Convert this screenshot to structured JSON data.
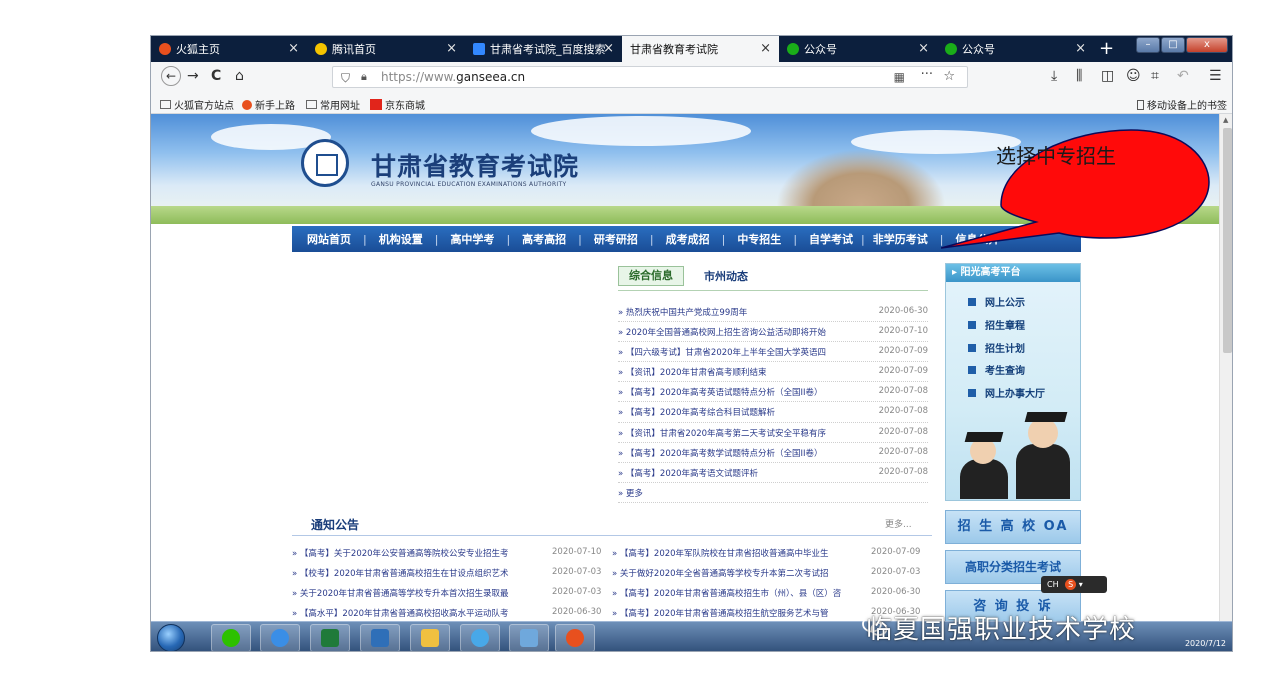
{
  "browser": {
    "tabs": [
      {
        "label": "火狐主页",
        "icon": "firefox-icon",
        "color": "#e8501e"
      },
      {
        "label": "腾讯首页",
        "icon": "qq-icon",
        "color": "#f5c400"
      },
      {
        "label": "甘肃省考试院_百度搜索",
        "icon": "baidu-paw-icon",
        "color": "#3388ff"
      },
      {
        "label": "甘肃省教育考试院",
        "icon": "",
        "color": ""
      },
      {
        "label": "公众号",
        "icon": "wechat-official-icon",
        "color": "#1aad19"
      },
      {
        "label": "公众号",
        "icon": "wechat-official-icon",
        "color": "#1aad19"
      }
    ],
    "new_tab": "+",
    "window_buttons": {
      "minimize": "–",
      "maximize": "□",
      "close": "x"
    },
    "nav": {
      "back": "←",
      "forward": "→",
      "reload": "C",
      "home": "⌂"
    },
    "url": {
      "protocol": "https://www.",
      "domain": "ganseea.cn"
    },
    "url_icons": {
      "qr": "▦",
      "more": "···",
      "star": "☆"
    },
    "toolbar": {
      "download": "⤓",
      "library": "⫼",
      "sidebar": "◫",
      "account": "☺",
      "screenshot": "⌗",
      "undo": "↶",
      "menu": "☰"
    },
    "bookmarks": [
      {
        "label": "火狐官方站点",
        "icon": "folder-icon"
      },
      {
        "label": "新手上路",
        "icon": "firefox-icon"
      },
      {
        "label": "常用网址",
        "icon": "folder-icon"
      },
      {
        "label": "京东商城",
        "icon": "jd-icon"
      }
    ],
    "mobile_bookmarks": "移动设备上的书签"
  },
  "site": {
    "title": "甘肃省教育考试院",
    "subtitle": "GANSU PROVINCIAL EDUCATION EXAMINATIONS AUTHORITY",
    "nav": [
      "网站首页",
      "机构设置",
      "高中学考",
      "高考高招",
      "研考研招",
      "成考成招",
      "中专招生",
      "自学考试",
      "非学历考试",
      "信息公开"
    ],
    "news_tabs": [
      "综合信息",
      "市州动态"
    ],
    "news": [
      {
        "title": "热烈庆祝中国共产党成立99周年",
        "date": "2020-06-30"
      },
      {
        "title": "2020年全国普通高校网上招生咨询公益活动即将开始",
        "date": "2020-07-10"
      },
      {
        "title": "【四六级考试】甘肃省2020年上半年全国大学英语四",
        "date": "2020-07-09"
      },
      {
        "title": "【资讯】2020年甘肃省高考顺利结束",
        "date": "2020-07-09"
      },
      {
        "title": "【高考】2020年高考英语试题特点分析（全国II卷）",
        "date": "2020-07-08"
      },
      {
        "title": "【高考】2020年高考综合科目试题解析",
        "date": "2020-07-08"
      },
      {
        "title": "【资讯】甘肃省2020年高考第二天考试安全平稳有序",
        "date": "2020-07-08"
      },
      {
        "title": "【高考】2020年高考数学试题特点分析（全国II卷）",
        "date": "2020-07-08"
      },
      {
        "title": "【高考】2020年高考语文试题评析",
        "date": "2020-07-08"
      }
    ],
    "news_more": "更多",
    "sidebar": {
      "title": "阳光高考平台",
      "items": [
        "网上公示",
        "招生章程",
        "招生计划",
        "考生查询",
        "网上办事大厅"
      ]
    },
    "notice_title": "通知公告",
    "notice_more": "更多...",
    "notices_left": [
      {
        "title": "【高考】关于2020年公安普通高等院校公安专业招生考",
        "date": "2020-07-10"
      },
      {
        "title": "【校考】2020年甘肃省普通高校招生在甘设点组织艺术",
        "date": "2020-07-03"
      },
      {
        "title": "关于2020年甘肃省普通高等学校专升本首次招生录取最",
        "date": "2020-07-03"
      },
      {
        "title": "【高水平】2020年甘肃省普通高校招收高水平运动队考",
        "date": "2020-06-30"
      }
    ],
    "notices_right": [
      {
        "title": "【高考】2020年军队院校在甘肃省招收普通高中毕业生",
        "date": "2020-07-09"
      },
      {
        "title": "关于做好2020年全省普通高等学校专升本第二次考试招",
        "date": "2020-07-03"
      },
      {
        "title": "【高考】2020年甘肃省普通高校招生市（州）、县（区）咨",
        "date": "2020-06-30"
      },
      {
        "title": "【高考】2020年甘肃省普通高校招生航空服务艺术与管",
        "date": "2020-06-30"
      }
    ],
    "side_buttons": [
      "招 生 高 校 OA",
      "高职分类招生考试",
      "咨 询 投 诉"
    ]
  },
  "callout": "选择中专招生",
  "ime": {
    "label": "CH",
    "s": "S"
  },
  "taskbar": {
    "date": "2020/7/12",
    "apps": [
      {
        "name": "wechat-taskbar-icon",
        "color": "#2dc100"
      },
      {
        "name": "ie-taskbar-icon",
        "color": "#3a8ee6"
      },
      {
        "name": "excel-taskbar-icon",
        "color": "#1f7a3a"
      },
      {
        "name": "store-taskbar-icon",
        "color": "#2f6fb8"
      },
      {
        "name": "folder-taskbar-icon",
        "color": "#f0c040"
      },
      {
        "name": "chat-taskbar-icon",
        "color": "#48a8e8"
      },
      {
        "name": "docs-taskbar-icon",
        "color": "#6fa8dc"
      },
      {
        "name": "firefox-taskbar-icon",
        "color": "#e8501e"
      }
    ]
  },
  "watermark": "临夏国强职业技术学校"
}
